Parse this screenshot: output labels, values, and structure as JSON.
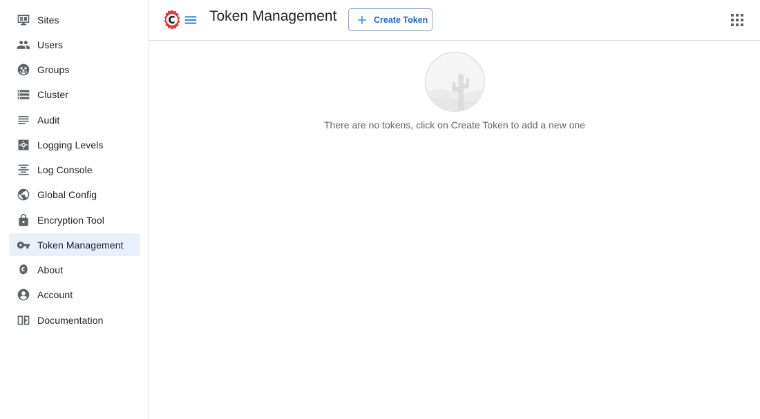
{
  "sidebar": {
    "items": [
      {
        "label": "Sites",
        "icon": "sites-icon"
      },
      {
        "label": "Users",
        "icon": "users-icon"
      },
      {
        "label": "Groups",
        "icon": "groups-icon"
      },
      {
        "label": "Cluster",
        "icon": "cluster-icon"
      },
      {
        "label": "Audit",
        "icon": "audit-icon"
      },
      {
        "label": "Logging Levels",
        "icon": "logging-levels-icon"
      },
      {
        "label": "Log Console",
        "icon": "log-console-icon"
      },
      {
        "label": "Global Config",
        "icon": "globe-icon"
      },
      {
        "label": "Encryption Tool",
        "icon": "lock-icon"
      },
      {
        "label": "Token Management",
        "icon": "key-icon",
        "active": true
      },
      {
        "label": "About",
        "icon": "about-icon"
      },
      {
        "label": "Account",
        "icon": "account-icon"
      },
      {
        "label": "Documentation",
        "icon": "documentation-icon"
      }
    ]
  },
  "header": {
    "title": "Token Management",
    "create_button_label": "Create Token",
    "logo_icon": "c-gear-logo",
    "menu_icon": "hamburger-menu-icon",
    "apps_icon": "apps-grid-icon"
  },
  "main": {
    "empty_message": "There are no tokens, click on Create Token to add a new one",
    "empty_icon": "empty-cactus-illustration"
  },
  "colors": {
    "accent": "#1a73e8",
    "active_nav_bg": "#e8f0fe",
    "logo_red": "#e53935"
  }
}
